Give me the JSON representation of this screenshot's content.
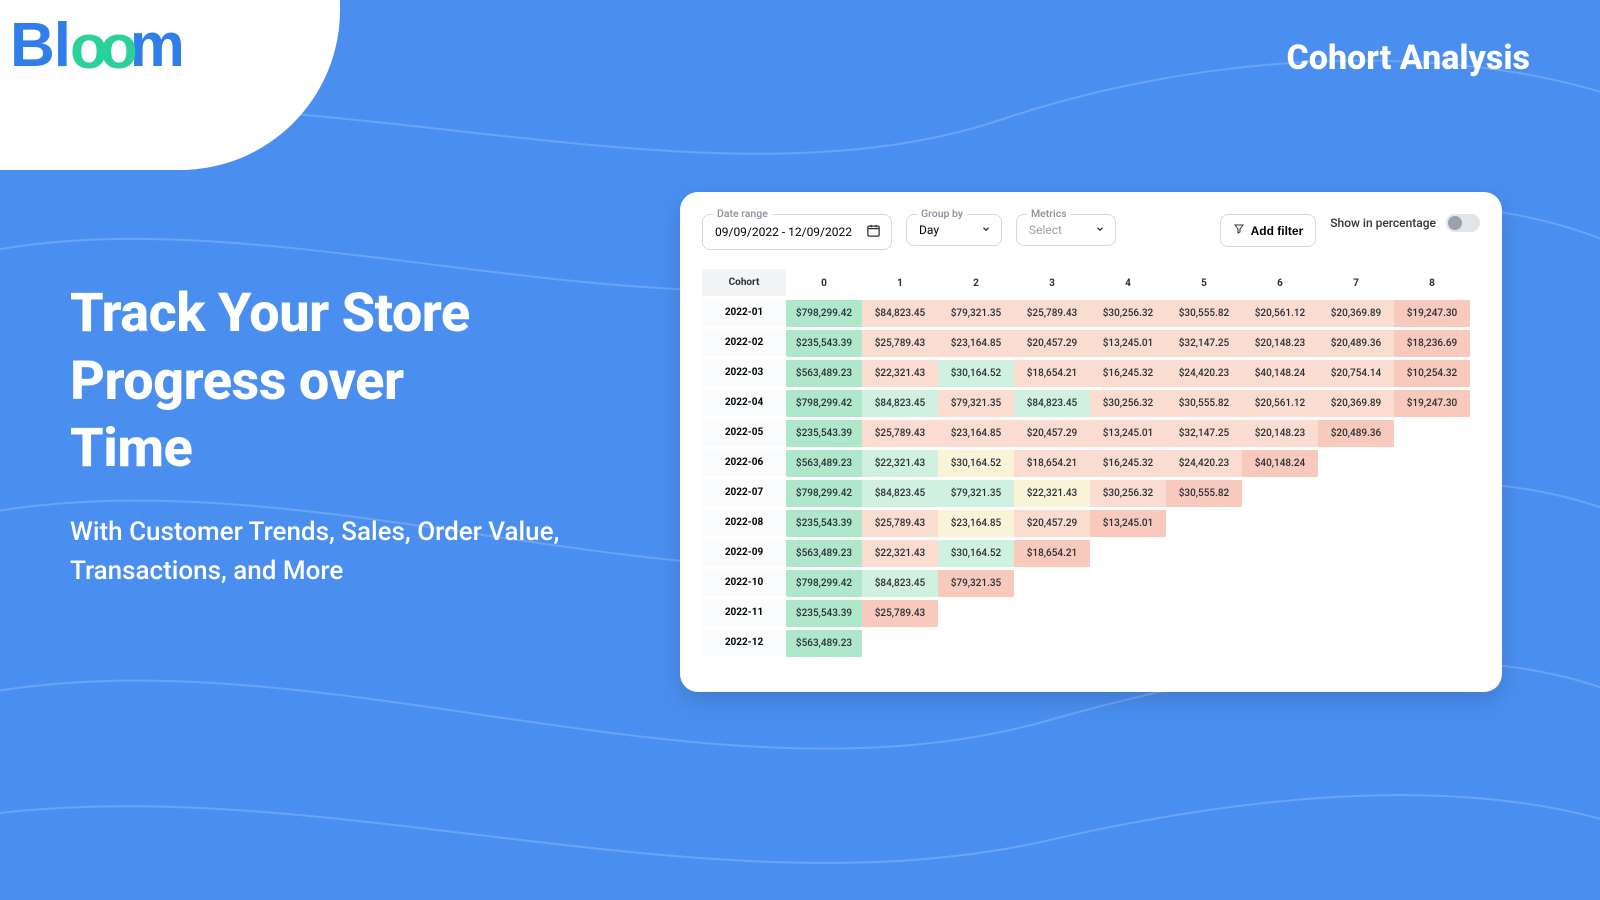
{
  "brand": {
    "part1": "Bl",
    "part2": "oo",
    "part3": "m"
  },
  "page_title": "Cohort Analysis",
  "hero": {
    "title_l1": "Track Your  Store",
    "title_l2": "Progress over",
    "title_l3": "Time",
    "subtitle": "With Customer Trends, Sales, Order Value, Transactions, and More"
  },
  "toolbar": {
    "date_label": "Date range",
    "date_value": "09/09/2022 - 12/09/2022",
    "group_label": "Group by",
    "group_value": "Day",
    "metrics_label": "Metrics",
    "metrics_value": "Select",
    "add_filter": "Add filter",
    "percent_label": "Show in percentage"
  },
  "table": {
    "row_header": "Cohort",
    "columns": [
      "0",
      "1",
      "2",
      "3",
      "4",
      "5",
      "6",
      "7",
      "8"
    ],
    "rows": [
      {
        "label": "2022-01",
        "cells": [
          {
            "v": "$798,299.42",
            "h": "g"
          },
          {
            "v": "$84,823.45",
            "h": "o"
          },
          {
            "v": "$79,321.35",
            "h": "o"
          },
          {
            "v": "$25,789.43",
            "h": "o"
          },
          {
            "v": "$30,256.32",
            "h": "o"
          },
          {
            "v": "$30,555.82",
            "h": "o"
          },
          {
            "v": "$20,561.12",
            "h": "o"
          },
          {
            "v": "$20,369.89",
            "h": "o"
          },
          {
            "v": "$19,247.30",
            "h": "r"
          }
        ]
      },
      {
        "label": "2022-02",
        "cells": [
          {
            "v": "$235,543.39",
            "h": "g"
          },
          {
            "v": "$25,789.43",
            "h": "o"
          },
          {
            "v": "$23,164.85",
            "h": "o"
          },
          {
            "v": "$20,457.29",
            "h": "o"
          },
          {
            "v": "$13,245.01",
            "h": "o"
          },
          {
            "v": "$32,147.25",
            "h": "o"
          },
          {
            "v": "$20,148.23",
            "h": "o"
          },
          {
            "v": "$20,489.36",
            "h": "o"
          },
          {
            "v": "$18,236.69",
            "h": "r"
          }
        ]
      },
      {
        "label": "2022-03",
        "cells": [
          {
            "v": "$563,489.23",
            "h": "g"
          },
          {
            "v": "$22,321.43",
            "h": "o"
          },
          {
            "v": "$30,164.52",
            "h": "l"
          },
          {
            "v": "$18,654.21",
            "h": "o"
          },
          {
            "v": "$16,245.32",
            "h": "o"
          },
          {
            "v": "$24,420.23",
            "h": "o"
          },
          {
            "v": "$40,148.24",
            "h": "o"
          },
          {
            "v": "$20,754.14",
            "h": "o"
          },
          {
            "v": "$10,254.32",
            "h": "r"
          }
        ]
      },
      {
        "label": "2022-04",
        "cells": [
          {
            "v": "$798,299.42",
            "h": "g"
          },
          {
            "v": "$84,823.45",
            "h": "l"
          },
          {
            "v": "$79,321.35",
            "h": "o"
          },
          {
            "v": "$84,823.45",
            "h": "l"
          },
          {
            "v": "$30,256.32",
            "h": "o"
          },
          {
            "v": "$30,555.82",
            "h": "o"
          },
          {
            "v": "$20,561.12",
            "h": "o"
          },
          {
            "v": "$20,369.89",
            "h": "o"
          },
          {
            "v": "$19,247.30",
            "h": "r"
          }
        ]
      },
      {
        "label": "2022-05",
        "cells": [
          {
            "v": "$235,543.39",
            "h": "g"
          },
          {
            "v": "$25,789.43",
            "h": "o"
          },
          {
            "v": "$23,164.85",
            "h": "o"
          },
          {
            "v": "$20,457.29",
            "h": "o"
          },
          {
            "v": "$13,245.01",
            "h": "o"
          },
          {
            "v": "$32,147.25",
            "h": "o"
          },
          {
            "v": "$20,148.23",
            "h": "o"
          },
          {
            "v": "$20,489.36",
            "h": "r"
          }
        ]
      },
      {
        "label": "2022-06",
        "cells": [
          {
            "v": "$563,489.23",
            "h": "g"
          },
          {
            "v": "$22,321.43",
            "h": "l"
          },
          {
            "v": "$30,164.52",
            "h": "y"
          },
          {
            "v": "$18,654.21",
            "h": "o"
          },
          {
            "v": "$16,245.32",
            "h": "o"
          },
          {
            "v": "$24,420.23",
            "h": "o"
          },
          {
            "v": "$40,148.24",
            "h": "r"
          }
        ]
      },
      {
        "label": "2022-07",
        "cells": [
          {
            "v": "$798,299.42",
            "h": "g"
          },
          {
            "v": "$84,823.45",
            "h": "l"
          },
          {
            "v": "$79,321.35",
            "h": "l"
          },
          {
            "v": "$22,321.43",
            "h": "y"
          },
          {
            "v": "$30,256.32",
            "h": "o"
          },
          {
            "v": "$30,555.82",
            "h": "r"
          }
        ]
      },
      {
        "label": "2022-08",
        "cells": [
          {
            "v": "$235,543.39",
            "h": "g"
          },
          {
            "v": "$25,789.43",
            "h": "o"
          },
          {
            "v": "$23,164.85",
            "h": "y"
          },
          {
            "v": "$20,457.29",
            "h": "o"
          },
          {
            "v": "$13,245.01",
            "h": "r"
          }
        ]
      },
      {
        "label": "2022-09",
        "cells": [
          {
            "v": "$563,489.23",
            "h": "g"
          },
          {
            "v": "$22,321.43",
            "h": "o"
          },
          {
            "v": "$30,164.52",
            "h": "l"
          },
          {
            "v": "$18,654.21",
            "h": "r"
          }
        ]
      },
      {
        "label": "2022-10",
        "cells": [
          {
            "v": "$798,299.42",
            "h": "g"
          },
          {
            "v": "$84,823.45",
            "h": "l"
          },
          {
            "v": "$79,321.35",
            "h": "r"
          }
        ]
      },
      {
        "label": "2022-11",
        "cells": [
          {
            "v": "$235,543.39",
            "h": "g"
          },
          {
            "v": "$25,789.43",
            "h": "r"
          }
        ]
      },
      {
        "label": "2022-12",
        "cells": [
          {
            "v": "$563,489.23",
            "h": "g"
          }
        ]
      }
    ]
  }
}
